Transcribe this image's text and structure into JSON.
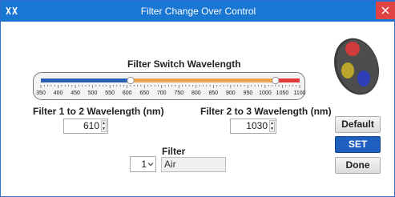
{
  "window": {
    "title": "Filter Change Over Control",
    "app_icon": "xx-app-icon",
    "close_icon": "close-icon"
  },
  "slider": {
    "title": "Filter Switch Wavelength",
    "min": 350,
    "max": 1100,
    "tick_labels": [
      "350",
      "400",
      "450",
      "500",
      "550",
      "600",
      "650",
      "700",
      "750",
      "800",
      "850",
      "900",
      "950",
      "1000",
      "1050",
      "1100"
    ],
    "handle1_value": 610,
    "handle2_value": 1030,
    "colors": {
      "blue": "#2b5fb5",
      "orange": "#f0a44e",
      "red": "#e53939"
    }
  },
  "filter_1_2": {
    "label": "Filter 1 to 2 Wavelength (nm)",
    "value": "610"
  },
  "filter_2_3": {
    "label": "Filter 2 to 3 Wavelength (nm)",
    "value": "1030"
  },
  "filter": {
    "label": "Filter",
    "selected_index": "1",
    "name": "Air"
  },
  "buttons": {
    "default": "Default",
    "set": "SET",
    "done": "Done"
  }
}
